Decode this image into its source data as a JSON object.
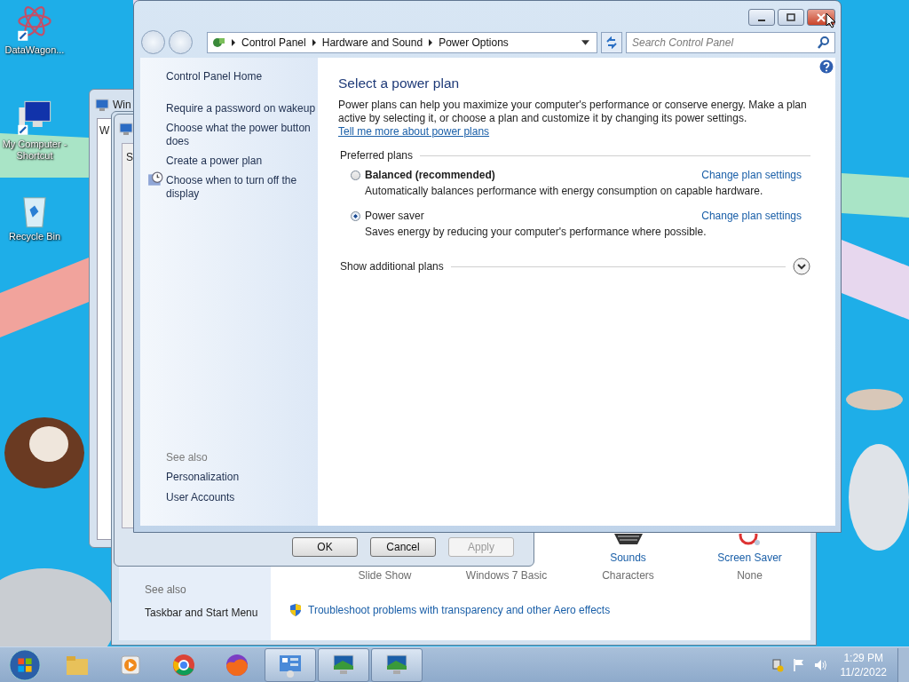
{
  "desktop_icons": [
    {
      "kind": "atom",
      "label": "DataWagon..."
    },
    {
      "kind": "computer",
      "label": "My Computer - Shortcut"
    },
    {
      "kind": "bin",
      "label": "Recycle Bin"
    }
  ],
  "back_window": {
    "title": "Win",
    "cut_text": "W"
  },
  "dialog": {
    "cut_text": "S",
    "buttons": [
      {
        "label": "OK",
        "disabled": false
      },
      {
        "label": "Cancel",
        "disabled": false
      },
      {
        "label": "Apply",
        "disabled": true
      }
    ]
  },
  "personalization": {
    "see_also": "See also",
    "links": [
      "Taskbar and Start Menu"
    ],
    "settings": [
      {
        "value": "Slide Show"
      },
      {
        "value": "Windows 7 Basic"
      },
      {
        "kind": "sounds",
        "label": "Sounds",
        "value": "Characters"
      },
      {
        "kind": "screensaver",
        "label": "Screen Saver",
        "value": "None"
      }
    ],
    "troubleshoot_link": "Troubleshoot problems with transparency and other Aero effects"
  },
  "window": {
    "breadcrumb": [
      "Control Panel",
      "Hardware and Sound",
      "Power Options"
    ],
    "search": {
      "placeholder": "Search Control Panel"
    },
    "sidebar": {
      "items": [
        {
          "label": "Control Panel Home",
          "icon": false
        },
        {
          "label": "Require a password on wakeup",
          "icon": false
        },
        {
          "label": "Choose what the power button does",
          "icon": false
        },
        {
          "label": "Create a power plan",
          "icon": false
        },
        {
          "label": "Choose when to turn off the display",
          "icon": true
        }
      ],
      "see_also": "See also",
      "see_also_items": [
        "Personalization",
        "User Accounts"
      ]
    },
    "heading": "Select a power plan",
    "description": "Power plans can help you maximize your computer's performance or conserve energy. Make a plan active by selecting it, or choose a plan and customize it by changing its power settings.",
    "description_link": "Tell me more about power plans",
    "group_label": "Preferred plans",
    "plans": [
      {
        "name": "Balanced (recommended)",
        "description": "Automatically balances performance with energy consumption on capable hardware.",
        "link": "Change plan settings",
        "selected": false
      },
      {
        "name": "Power saver",
        "description": "Saves energy by reducing your computer's performance where possible.",
        "link": "Change plan settings",
        "selected": true
      }
    ],
    "additional_plans": {
      "label": "Show additional plans",
      "expanded": false
    }
  },
  "taskbar": {
    "apps": [
      {
        "kind": "folder",
        "open": false
      },
      {
        "kind": "media",
        "open": false
      },
      {
        "kind": "ball",
        "open": false
      },
      {
        "kind": "fox",
        "open": false
      },
      {
        "kind": "panel",
        "open": true
      },
      {
        "kind": "monitor",
        "open": true
      },
      {
        "kind": "monitor",
        "open": true
      }
    ],
    "time": "1:29 PM",
    "date": "11/2/2022"
  }
}
